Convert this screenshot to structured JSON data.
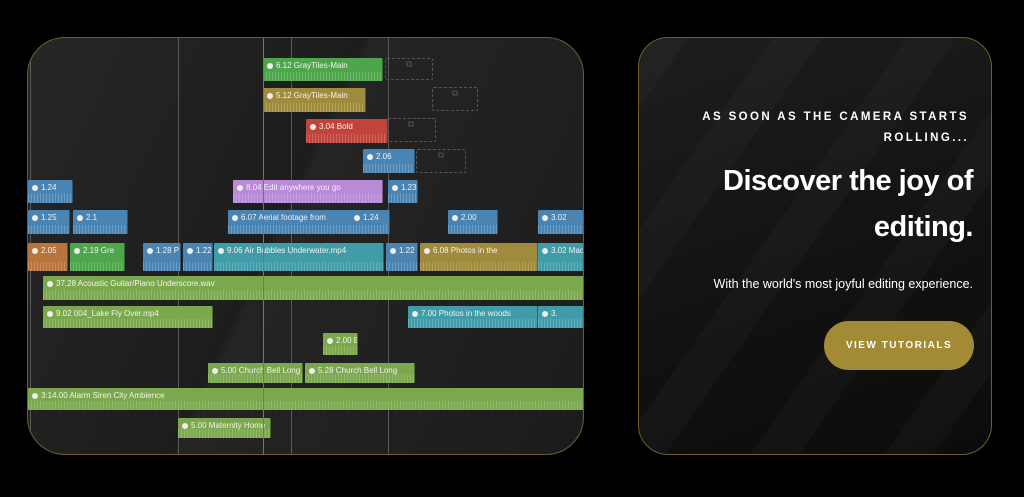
{
  "timeline": {
    "clips": [
      {
        "label": "6.12  GrayTiles-Main",
        "color": "#4da74a"
      },
      {
        "label": "5.12  GrayTiles-Main",
        "color": "#a08a3c"
      },
      {
        "label": "3.04  Bold",
        "color": "#c0443c"
      },
      {
        "label": "2.06",
        "color": "#4a84b3"
      },
      {
        "label": "1.24",
        "color": "#4a84b3"
      },
      {
        "label": "8.04  Edit anywhere you go",
        "color": "#b88ad8"
      },
      {
        "label": "1.23",
        "color": "#4a84b3"
      },
      {
        "label": "1.25",
        "color": "#4a84b3"
      },
      {
        "label": "2.1",
        "color": "#4a84b3"
      },
      {
        "label": "6.07  Aerial footage from",
        "color": "#4a84b3"
      },
      {
        "label": "1.24",
        "color": "#4a84b3"
      },
      {
        "label": "2.00",
        "color": "#4a84b3"
      },
      {
        "label": "3.02",
        "color": "#4a84b3"
      },
      {
        "label": "2.05",
        "color": "#b8743a"
      },
      {
        "label": "2.19  Gre",
        "color": "#4da74a"
      },
      {
        "label": "1.28  P",
        "color": "#4a84b3"
      },
      {
        "label": "1.22",
        "color": "#4a84b3"
      },
      {
        "label": "9.06  Air Bubbles Underwater.mp4",
        "color": "#3f9ca8"
      },
      {
        "label": "1.22",
        "color": "#4a84b3"
      },
      {
        "label": "6.08  Photos in the",
        "color": "#a08a3c"
      },
      {
        "label": "3.02  Mac",
        "color": "#3f9ca8"
      },
      {
        "label": "37.28  Acoustic Guitar/Piano Underscore.wav",
        "color": "#7ba84c"
      },
      {
        "label": "9.02  004_Lake Fly Over.mp4",
        "color": "#7ba84c"
      },
      {
        "label": "7.00  Photos in the woods",
        "color": "#3f9ca8"
      },
      {
        "label": "3.",
        "color": "#3f9ca8"
      },
      {
        "label": "2.00  Bi",
        "color": "#7ba84c"
      },
      {
        "label": "5.00  Church Bell Long",
        "color": "#7ba84c"
      },
      {
        "label": "5.28  Church Bell Long",
        "color": "#7ba84c"
      },
      {
        "label": "3:14.00  Alarm Siren City Ambience",
        "color": "#7ba84c"
      },
      {
        "label": "5.00  Maternity Home",
        "color": "#7ba84c"
      }
    ]
  },
  "promo": {
    "eyebrow": "AS SOON AS THE CAMERA STARTS ROLLING...",
    "headline": "Discover the joy of editing.",
    "subtext": "With the world's most joyful editing experience.",
    "cta_label": "VIEW TUTORIALS",
    "accent_color": "#a38a35"
  }
}
